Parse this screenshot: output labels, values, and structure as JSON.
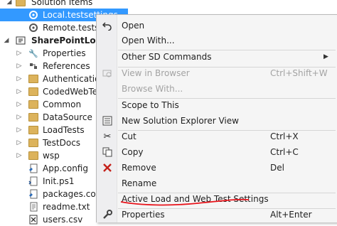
{
  "tree": {
    "solution_items": "Solution Items",
    "local_testsettings": "Local.testsettings",
    "remote_testsettings": "Remote.testset",
    "project": "SharePointLoadG",
    "properties": "Properties",
    "references": "References",
    "authentication": "Authentication",
    "codedwebtests": "CodedWebTests",
    "common": "Common",
    "datasource": "DataSource",
    "loadtests": "LoadTests",
    "testdocs": "TestDocs",
    "wsp": "wsp",
    "app_config": "App.config",
    "init_ps1": "Init.ps1",
    "packages_config": "packages.confi",
    "readme": "readme.txt",
    "users_csv": "users.csv"
  },
  "menu": {
    "open": "Open",
    "open_with": "Open With...",
    "other_sd_commands": "Other SD Commands",
    "view_in_browser": "View in Browser",
    "view_in_browser_shortcut": "Ctrl+Shift+W",
    "browse_with": "Browse With...",
    "scope_to_this": "Scope to This",
    "new_solution_explorer_view": "New Solution Explorer View",
    "cut": "Cut",
    "cut_shortcut": "Ctrl+X",
    "copy": "Copy",
    "copy_shortcut": "Ctrl+C",
    "remove": "Remove",
    "remove_shortcut": "Del",
    "rename": "Rename",
    "active_load_web_test_settings": "Active Load and Web Test Settings",
    "properties": "Properties",
    "properties_shortcut": "Alt+Enter"
  },
  "icons": {
    "open": "undo-arrow-icon",
    "view_in_browser": "browser-icon",
    "new_view": "solution-explorer-icon",
    "cut": "scissors-icon",
    "copy": "copy-icon",
    "remove": "red-x-icon",
    "properties": "wrench-icon"
  },
  "colors": {
    "selection": "#3399ff",
    "menu_background": "#f5f5f5",
    "remove_icon": "#c4211a",
    "annotation": "#e8141b"
  }
}
